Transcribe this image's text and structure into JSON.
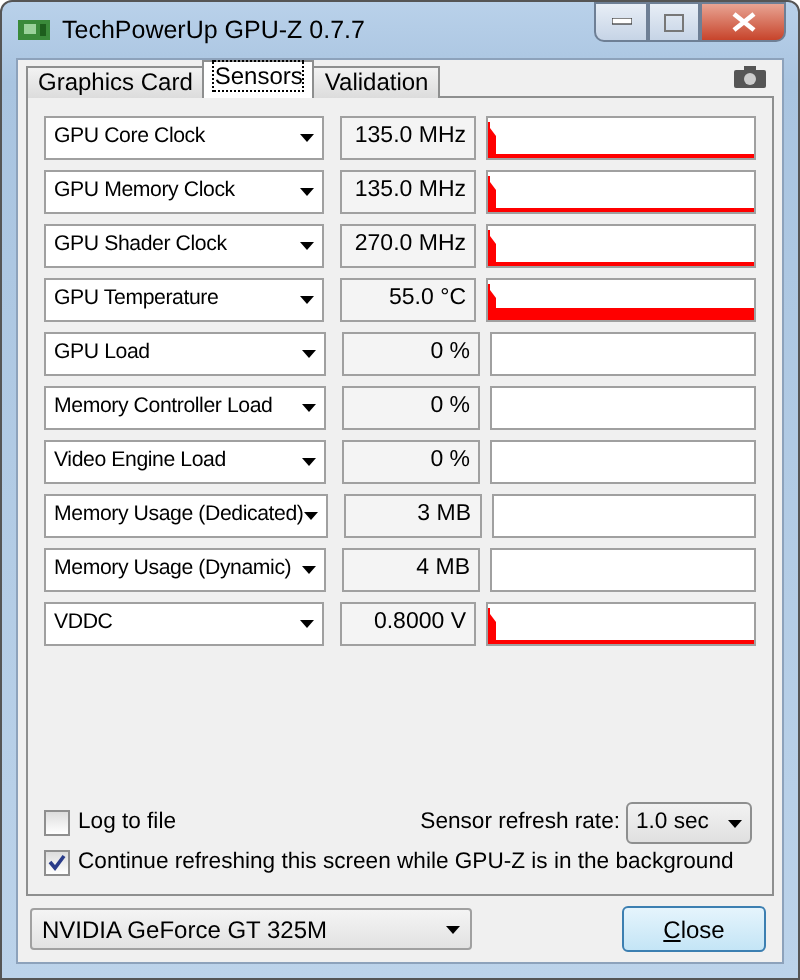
{
  "window": {
    "title": "TechPowerUp GPU-Z 0.7.7"
  },
  "tabs": [
    {
      "label": "Graphics Card",
      "selected": false
    },
    {
      "label": "Sensors",
      "selected": true
    },
    {
      "label": "Validation",
      "selected": false
    }
  ],
  "sensors": [
    {
      "name": "GPU Core Clock",
      "value": "135.0 MHz",
      "kind": "thin"
    },
    {
      "name": "GPU Memory Clock",
      "value": "135.0 MHz",
      "kind": "thin"
    },
    {
      "name": "GPU Shader Clock",
      "value": "270.0 MHz",
      "kind": "thin"
    },
    {
      "name": "GPU Temperature",
      "value": "55.0 °C",
      "kind": "thick"
    },
    {
      "name": "GPU Load",
      "value": "0 %",
      "kind": "empty"
    },
    {
      "name": "Memory Controller Load",
      "value": "0 %",
      "kind": "empty"
    },
    {
      "name": "Video Engine Load",
      "value": "0 %",
      "kind": "empty"
    },
    {
      "name": "Memory Usage (Dedicated)",
      "value": "3 MB",
      "kind": "empty"
    },
    {
      "name": "Memory Usage (Dynamic)",
      "value": "4 MB",
      "kind": "empty"
    },
    {
      "name": "VDDC",
      "value": "0.8000 V",
      "kind": "thin"
    }
  ],
  "options": [
    {
      "label": "Log to file",
      "checked": false
    },
    {
      "label": "Continue refreshing this screen while GPU-Z is in the background",
      "checked": true
    }
  ],
  "refresh": {
    "label": "Sensor refresh rate:",
    "value": "1.0 sec"
  },
  "device": {
    "value": "NVIDIA GeForce GT 325M"
  },
  "close_button": "Close"
}
